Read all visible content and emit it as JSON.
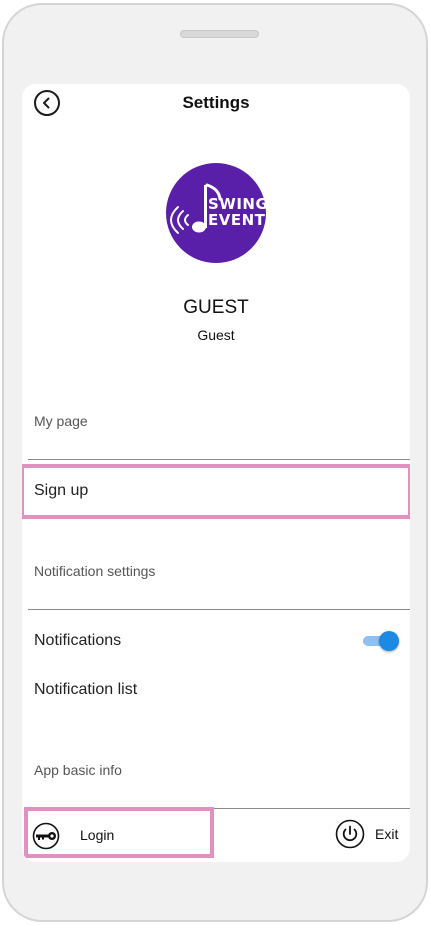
{
  "header": {
    "title": "Settings",
    "back_icon": "chevron-left-icon"
  },
  "profile": {
    "logo_line1": "SWING",
    "logo_line2": "EVENT",
    "logo_color": "#5a1fa8",
    "name": "GUEST",
    "role": "Guest"
  },
  "sections": {
    "my_page": {
      "title": "My page",
      "sign_up": "Sign up"
    },
    "notification_settings": {
      "title": "Notification settings",
      "notifications": "Notifications",
      "notifications_enabled": true,
      "notification_list": "Notification list"
    },
    "app_basic_info": {
      "title": "App basic info"
    }
  },
  "footer": {
    "login_label": "Login",
    "login_icon": "key-icon",
    "exit_label": "Exit",
    "exit_icon": "power-icon"
  },
  "colors": {
    "highlight": "#e091bf",
    "toggle_on": "#1e88e5"
  }
}
